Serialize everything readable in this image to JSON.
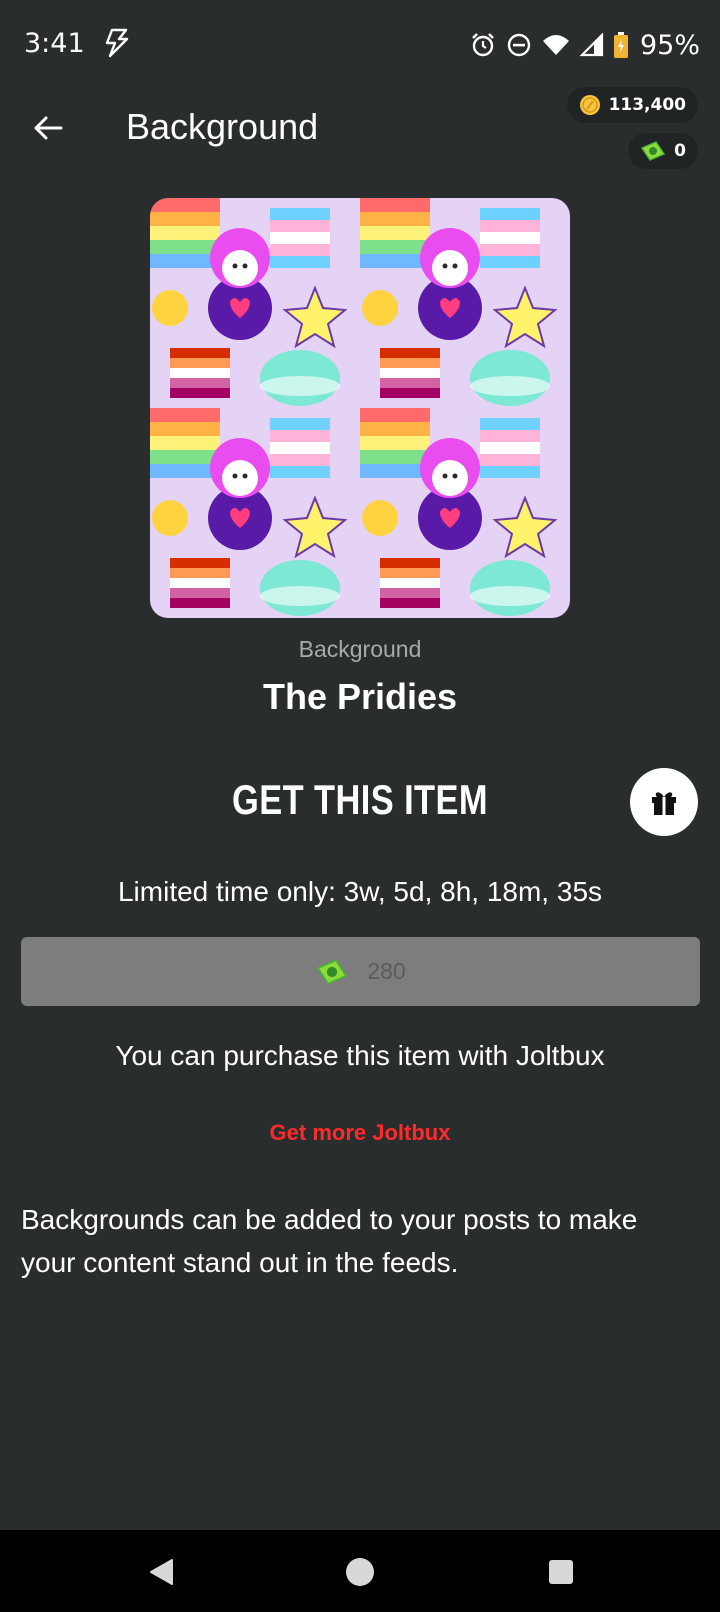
{
  "status_bar": {
    "time": "3:41",
    "battery": "95%"
  },
  "app_bar": {
    "title": "Background"
  },
  "wallet": {
    "coins": "113,400",
    "joltbux": "0"
  },
  "item": {
    "type_label": "Background",
    "name": "The Pridies"
  },
  "purchase": {
    "heading": "GET THIS ITEM",
    "limited_time": "Limited time only: 3w, 5d, 8h, 18m, 35s",
    "price": "280",
    "info": "You can purchase this item with Joltbux",
    "get_more_link": "Get more Joltbux"
  },
  "description": "Backgrounds can be added to your posts to make your content stand out in the feeds.",
  "colors": {
    "background": "#292d2e",
    "accent_link": "#ff2a2a",
    "button_disabled": "#7d7d7d",
    "nav_bar": "#000000"
  },
  "icons": [
    "lightning-icon",
    "alarm-icon",
    "dnd-icon",
    "wifi-icon",
    "signal-icon",
    "battery-icon",
    "back-arrow-icon",
    "coin-icon",
    "joltbux-icon",
    "gift-icon",
    "nav-back-icon",
    "nav-home-icon",
    "nav-recents-icon"
  ]
}
